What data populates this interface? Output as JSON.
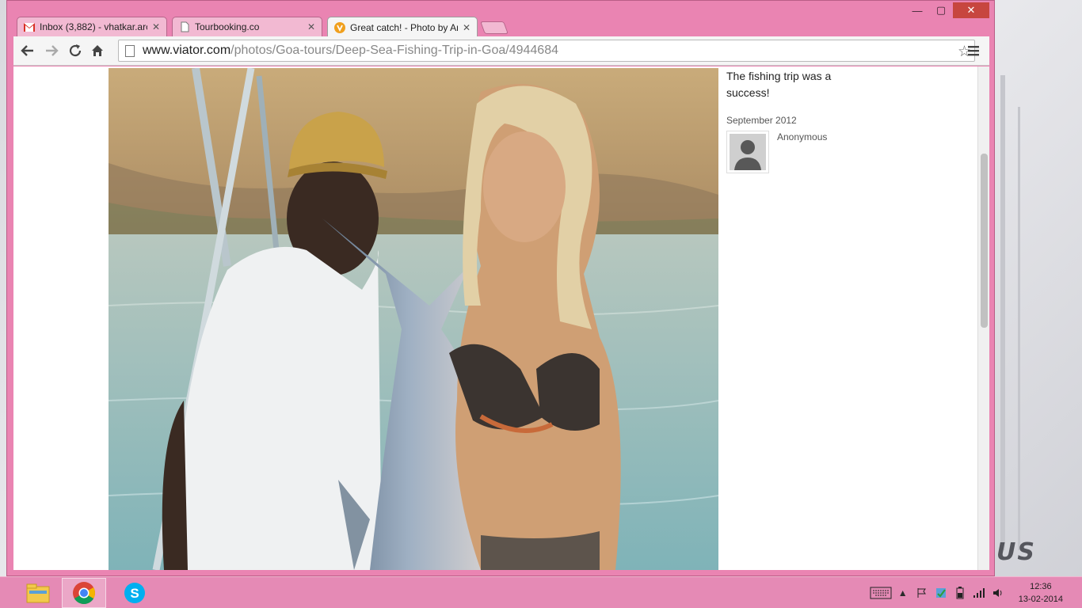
{
  "tabs": [
    {
      "title": "Inbox (3,882) - vhatkar.arc",
      "favicon": "gmail-icon",
      "active": false
    },
    {
      "title": "Tourbooking.co",
      "favicon": "page-icon",
      "active": false
    },
    {
      "title": "Great catch! - Photo by Ar",
      "favicon": "viator-icon",
      "active": true
    }
  ],
  "toolbar": {
    "url_host": "www.viator.com",
    "url_path": "/photos/Goa-tours/Deep-Sea-Fishing-Trip-in-Goa/4944684"
  },
  "page": {
    "caption": "The fishing trip was a success!",
    "date": "September 2012",
    "reviewer": "Anonymous"
  },
  "taskbar": {
    "apps": [
      "file-explorer-icon",
      "chrome-icon",
      "skype-icon"
    ],
    "time": "12:36",
    "date": "13-02-2014"
  },
  "colors": {
    "window_frame": "#ea84b2",
    "taskbar": "#e58ab5",
    "close_button": "#c7463f"
  }
}
